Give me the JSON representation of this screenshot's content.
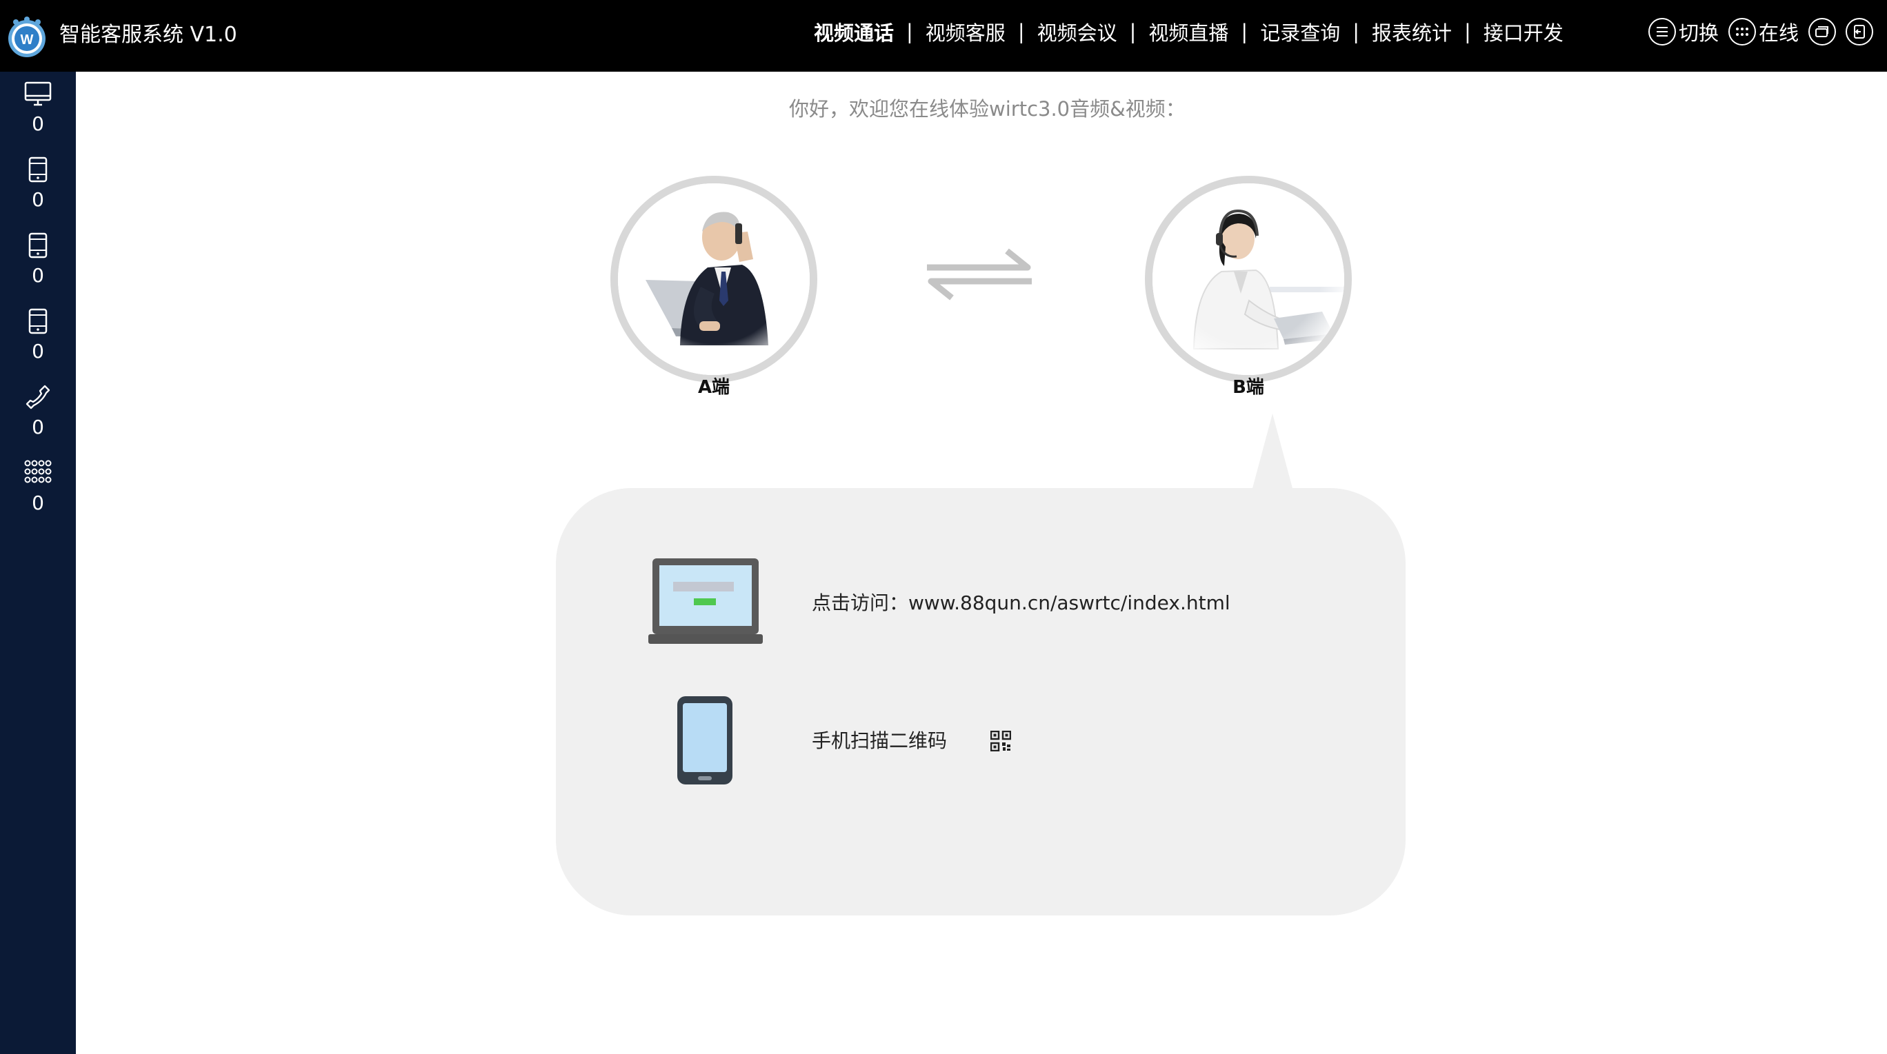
{
  "app": {
    "title": "智能客服系统 V1.0"
  },
  "nav": {
    "items": [
      {
        "label": "视频通话",
        "active": true
      },
      {
        "label": "视频客服",
        "active": false
      },
      {
        "label": "视频会议",
        "active": false
      },
      {
        "label": "视频直播",
        "active": false
      },
      {
        "label": "记录查询",
        "active": false
      },
      {
        "label": "报表统计",
        "active": false
      },
      {
        "label": "接口开发",
        "active": false
      }
    ],
    "separator": "|"
  },
  "actions": {
    "switch_label": "切换",
    "online_label": "在线"
  },
  "sidebar": {
    "items": [
      {
        "icon": "monitor-icon",
        "count": "0"
      },
      {
        "icon": "tablet-icon",
        "count": "0"
      },
      {
        "icon": "tablet-icon",
        "count": "0"
      },
      {
        "icon": "tablet-icon",
        "count": "0"
      },
      {
        "icon": "phone-handset-icon",
        "count": "0"
      },
      {
        "icon": "dialpad-icon",
        "count": "0"
      }
    ]
  },
  "main": {
    "welcome": "你好，欢迎您在线体验wirtc3.0音频&视频：",
    "side_a_label": "A端",
    "side_b_label": "B端",
    "visit_text": "点击访问：www.88qun.cn/aswrtc/index.html",
    "scan_text": "手机扫描二维码"
  },
  "colors": {
    "topbar": "#000000",
    "sidebar": "#0b1a36",
    "bubble": "#f0f0f0",
    "avatar_ring": "#d8d8d8"
  }
}
